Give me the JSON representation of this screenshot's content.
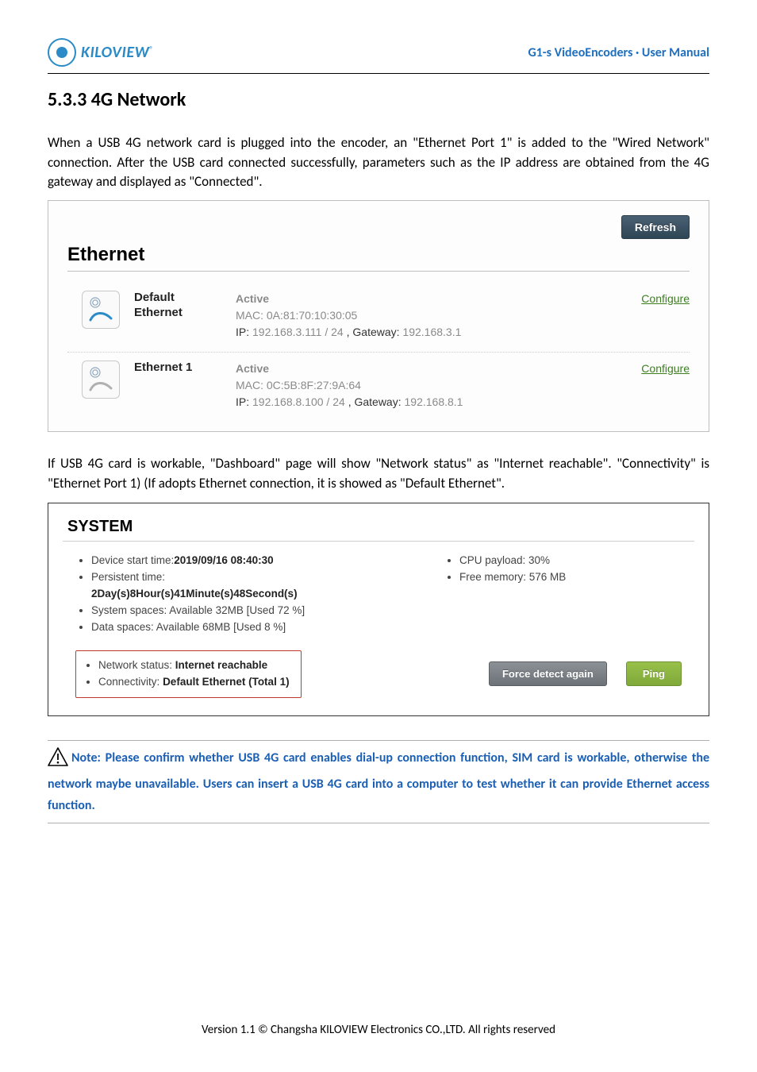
{
  "header": {
    "brand": "KILOVIEW",
    "reg": "®",
    "right": "G1-s VideoEncoders · User Manual"
  },
  "section_title": "5.3.3 4G Network",
  "para1": "When a USB 4G network card is plugged into the encoder, an \"Ethernet Port 1\" is added to the \"Wired Network\" connection. After the USB card connected successfully, parameters such as the IP address are obtained from the 4G gateway and displayed as \"Connected\".",
  "ethernet_panel": {
    "refresh": "Refresh",
    "title": "Ethernet",
    "rows": [
      {
        "name": "Default Ethernet",
        "active": "Active",
        "mac_label": "MAC:",
        "mac": "0A:81:70:10:30:05",
        "ip_label": "IP:",
        "ip": "192.168.3.111 / 24",
        "gw_label": ", Gateway:",
        "gw": "192.168.3.1",
        "configure": "Configure"
      },
      {
        "name": "Ethernet 1",
        "active": "Active",
        "mac_label": "MAC:",
        "mac": "0C:5B:8F:27:9A:64",
        "ip_label": "IP:",
        "ip": "192.168.8.100 / 24",
        "gw_label": ", Gateway:",
        "gw": "192.168.8.1",
        "configure": "Configure"
      }
    ]
  },
  "para2": "If USB 4G card is workable, \"Dashboard\" page will show \"Network status\" as \"Internet reachable\". \"Connectivity\" is \"Ethernet Port 1) (If adopts Ethernet connection, it is showed as \"Default Ethernet\".",
  "system_panel": {
    "title": "SYSTEM",
    "left": {
      "start_label": "Device start time:",
      "start_val": "2019/09/16 08:40:30",
      "persist_label": "Persistent time:",
      "persist_val": "2Day(s)8Hour(s)41Minute(s)48Second(s)",
      "sys_space_full": "System spaces: Available 32MB [Used 72 %]",
      "data_space_full": "Data spaces: Available 68MB [Used 8 %]"
    },
    "right": {
      "cpu_full": "CPU payload: 30%",
      "mem_full": "Free memory: 576 MB"
    },
    "net": {
      "status_label": "Network status:",
      "status_val": "Internet reachable",
      "conn_label": "Connectivity:",
      "conn_val": "Default Ethernet (Total 1)"
    },
    "btn_force": "Force detect again",
    "btn_ping": "Ping"
  },
  "note": "Note: Please confirm whether USB 4G card enables dial-up connection function, SIM card is workable, otherwise the network maybe unavailable. Users can insert a USB 4G card into a computer to test whether it can provide Ethernet access function.",
  "footer": "Version 1.1 © Changsha KILOVIEW Electronics CO.,LTD. All rights reserved"
}
